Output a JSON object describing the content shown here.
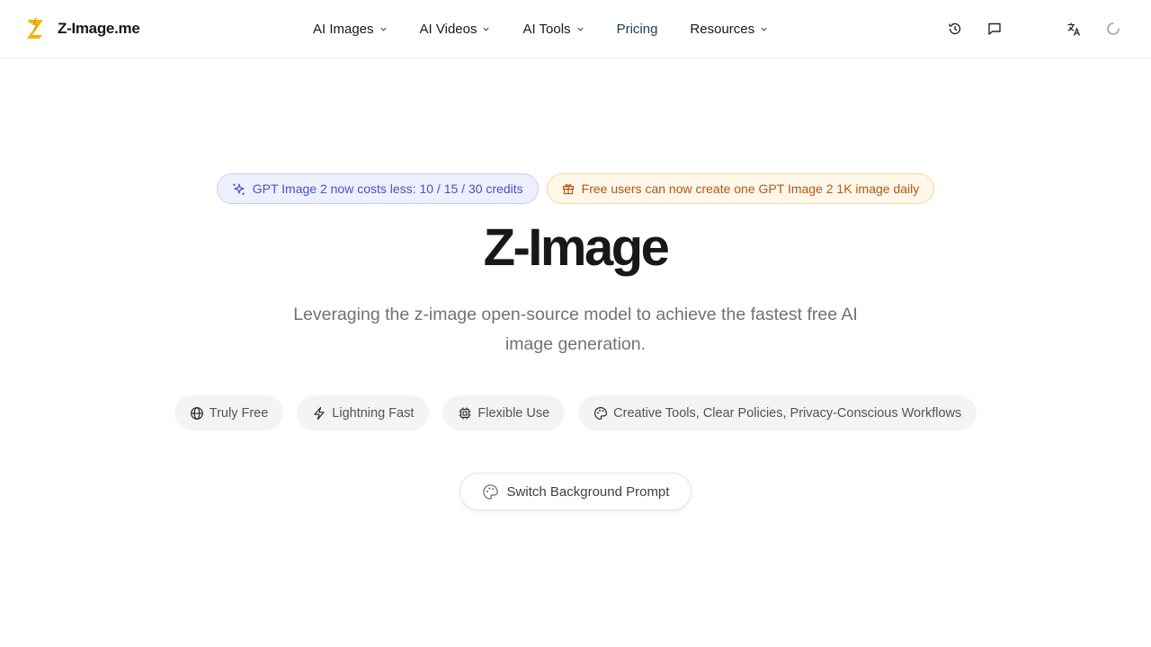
{
  "brand": {
    "name": "Z-Image.me",
    "logo_icon": "z-lightning-logo",
    "accent": "#f5b800"
  },
  "nav": {
    "items": [
      {
        "label": "AI Images",
        "has_dropdown": true
      },
      {
        "label": "AI Videos",
        "has_dropdown": true
      },
      {
        "label": "AI Tools",
        "has_dropdown": true
      },
      {
        "label": "Pricing",
        "has_dropdown": false
      },
      {
        "label": "Resources",
        "has_dropdown": true
      }
    ]
  },
  "header_actions": [
    "history-icon",
    "message-icon",
    "translate-icon",
    "loading-spinner-icon"
  ],
  "announcements": {
    "credits": {
      "text": "GPT Image 2 now costs less: 10 / 15 / 30 credits",
      "icon": "sparkles-icon",
      "color": "#4a4fc7"
    },
    "free": {
      "text": "Free users can now create one GPT Image 2 1K image daily",
      "icon": "gift-icon",
      "color": "#b4570f"
    }
  },
  "hero": {
    "title": "Z-Image",
    "subtitle": "Leveraging the z-image open-source model to achieve the fastest free AI image generation."
  },
  "features": [
    {
      "label": "Truly Free",
      "icon": "globe-icon"
    },
    {
      "label": "Lightning Fast",
      "icon": "lightning-icon"
    },
    {
      "label": "Flexible Use",
      "icon": "chip-icon"
    },
    {
      "label": "Creative Tools, Clear Policies, Privacy-Conscious Workflows",
      "icon": "palette-icon"
    }
  ],
  "switch_button": {
    "label": "Switch Background Prompt",
    "icon": "palette-icon"
  }
}
